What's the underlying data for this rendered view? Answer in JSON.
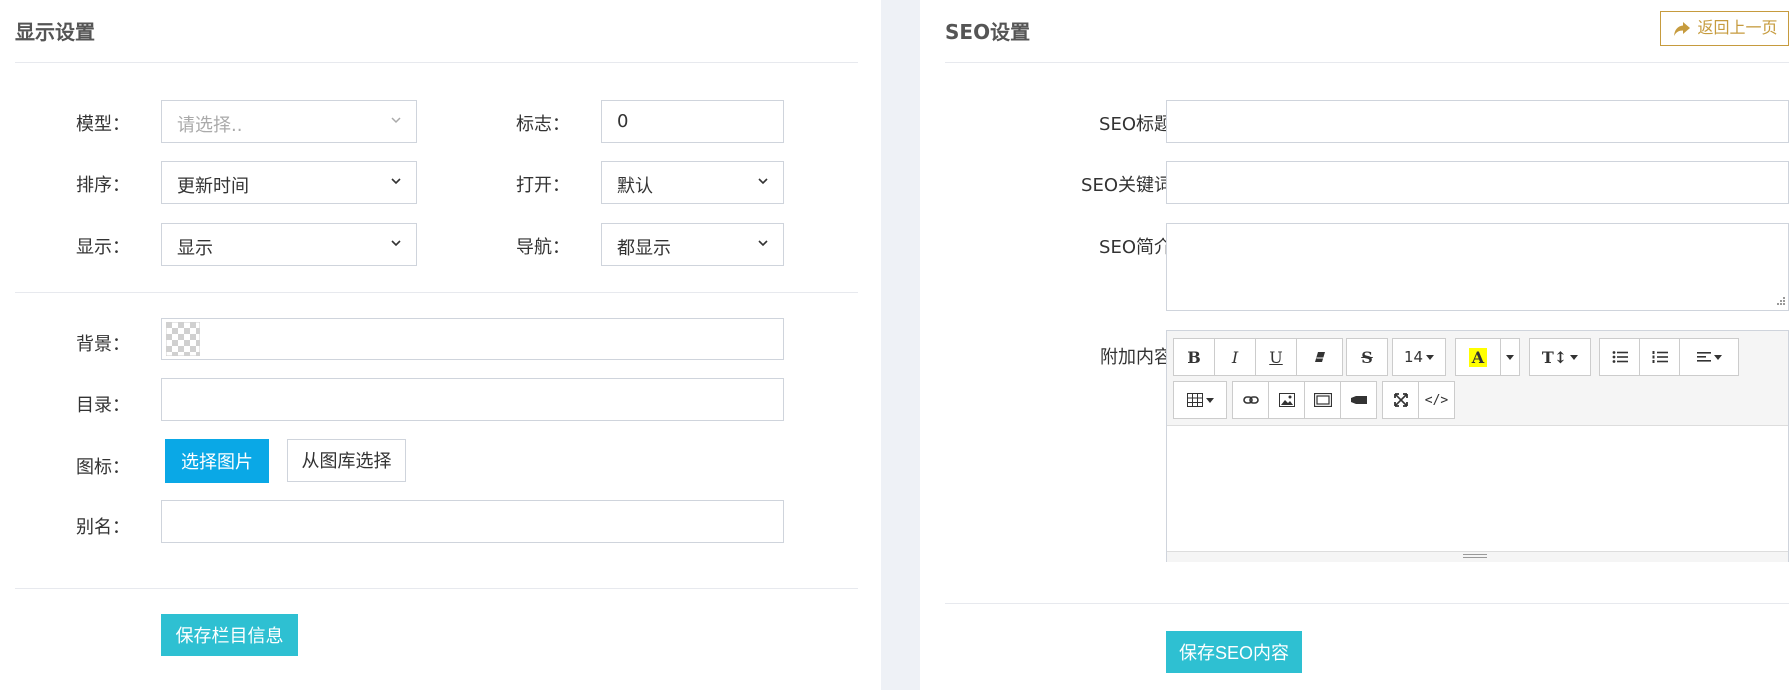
{
  "left": {
    "title": "显示设置",
    "labels": {
      "model": "模型：",
      "sort": "排序：",
      "display": "显示：",
      "flag": "标志：",
      "open": "打开：",
      "nav": "导航：",
      "bg": "背景：",
      "dir": "目录：",
      "icon": "图标：",
      "alias": "别名："
    },
    "model_placeholder": "请选择..",
    "sort_value": "更新时间",
    "display_value": "显示",
    "flag_value": "0",
    "open_value": "默认",
    "nav_value": "都显示",
    "dir_value": "",
    "alias_value": "",
    "choose_image_label": "选择图片",
    "from_gallery_label": "从图库选择",
    "save_label": "保存栏目信息"
  },
  "right": {
    "title": "SEO设置",
    "back_label": "返回上一页",
    "labels": {
      "seo_title": "SEO标题：",
      "seo_keywords": "SEO关键词：",
      "seo_desc": "SEO简介：",
      "extra": "附加内容："
    },
    "seo_title_value": "",
    "seo_keywords_value": "",
    "seo_desc_value": "",
    "editor": {
      "font_size": "14"
    },
    "save_label": "保存SEO内容"
  },
  "colors": {
    "accent_blue": "#0aa8e6",
    "teal": "#2ec0d2",
    "back_gold": "#c69b3e",
    "highlight_yellow": "#ffff00"
  }
}
